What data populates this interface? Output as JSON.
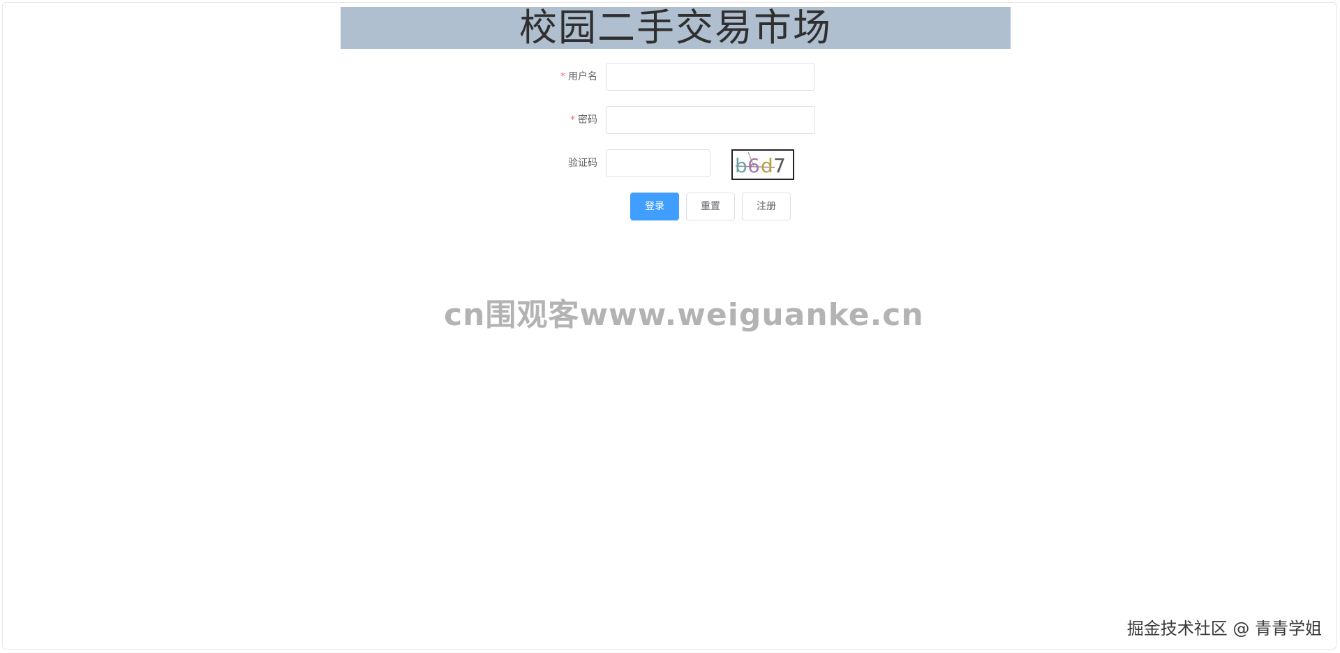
{
  "header": {
    "title": "校园二手交易市场"
  },
  "form": {
    "username": {
      "required_mark": "*",
      "label": "用户名",
      "value": "",
      "placeholder": ""
    },
    "password": {
      "required_mark": "*",
      "label": "密码",
      "value": "",
      "placeholder": ""
    },
    "captcha": {
      "label": "验证码",
      "value": "",
      "placeholder": "",
      "image_text": "b6d7"
    }
  },
  "buttons": {
    "login": "登录",
    "reset": "重置",
    "register": "注册"
  },
  "watermarks": {
    "center": "cn围观客www.weiguanke.cn",
    "corner": "掘金技术社区 @ 青青学姐"
  },
  "colors": {
    "banner_bg": "#b0bfcf",
    "primary": "#409eff",
    "required": "#f56c6c"
  }
}
